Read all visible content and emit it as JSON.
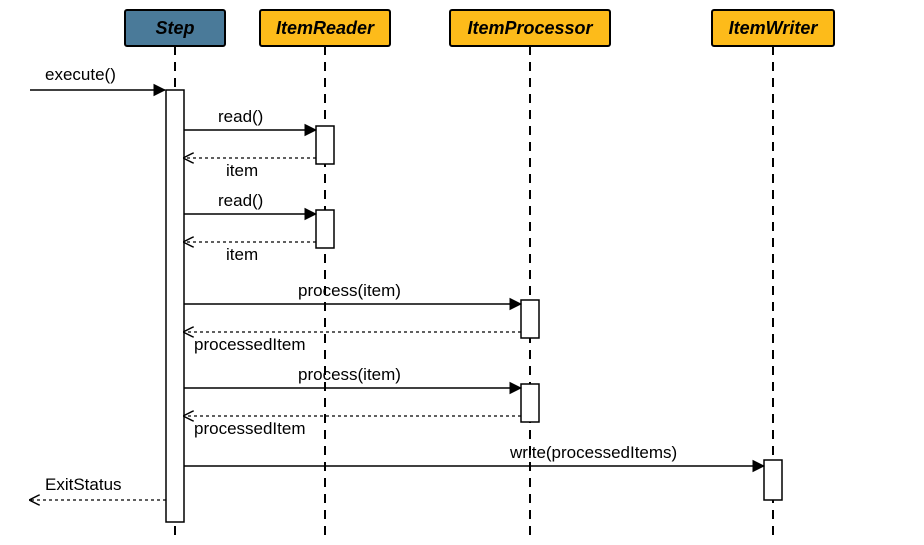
{
  "diagram": {
    "type": "sequence",
    "participants": [
      {
        "id": "step",
        "label": "Step",
        "kind": "primary"
      },
      {
        "id": "reader",
        "label": "ItemReader",
        "kind": "secondary"
      },
      {
        "id": "processor",
        "label": "ItemProcessor",
        "kind": "secondary"
      },
      {
        "id": "writer",
        "label": "ItemWriter",
        "kind": "secondary"
      }
    ],
    "incoming": {
      "label": "execute()"
    },
    "messages": [
      {
        "from": "step",
        "to": "reader",
        "call": "read()",
        "return": "item"
      },
      {
        "from": "step",
        "to": "reader",
        "call": "read()",
        "return": "item"
      },
      {
        "from": "step",
        "to": "processor",
        "call": "process(item)",
        "return": "processedItem"
      },
      {
        "from": "step",
        "to": "processor",
        "call": "process(item)",
        "return": "processedItem"
      },
      {
        "from": "step",
        "to": "writer",
        "call": "write(processedItems)"
      }
    ],
    "outgoing": {
      "label": "ExitStatus"
    }
  }
}
